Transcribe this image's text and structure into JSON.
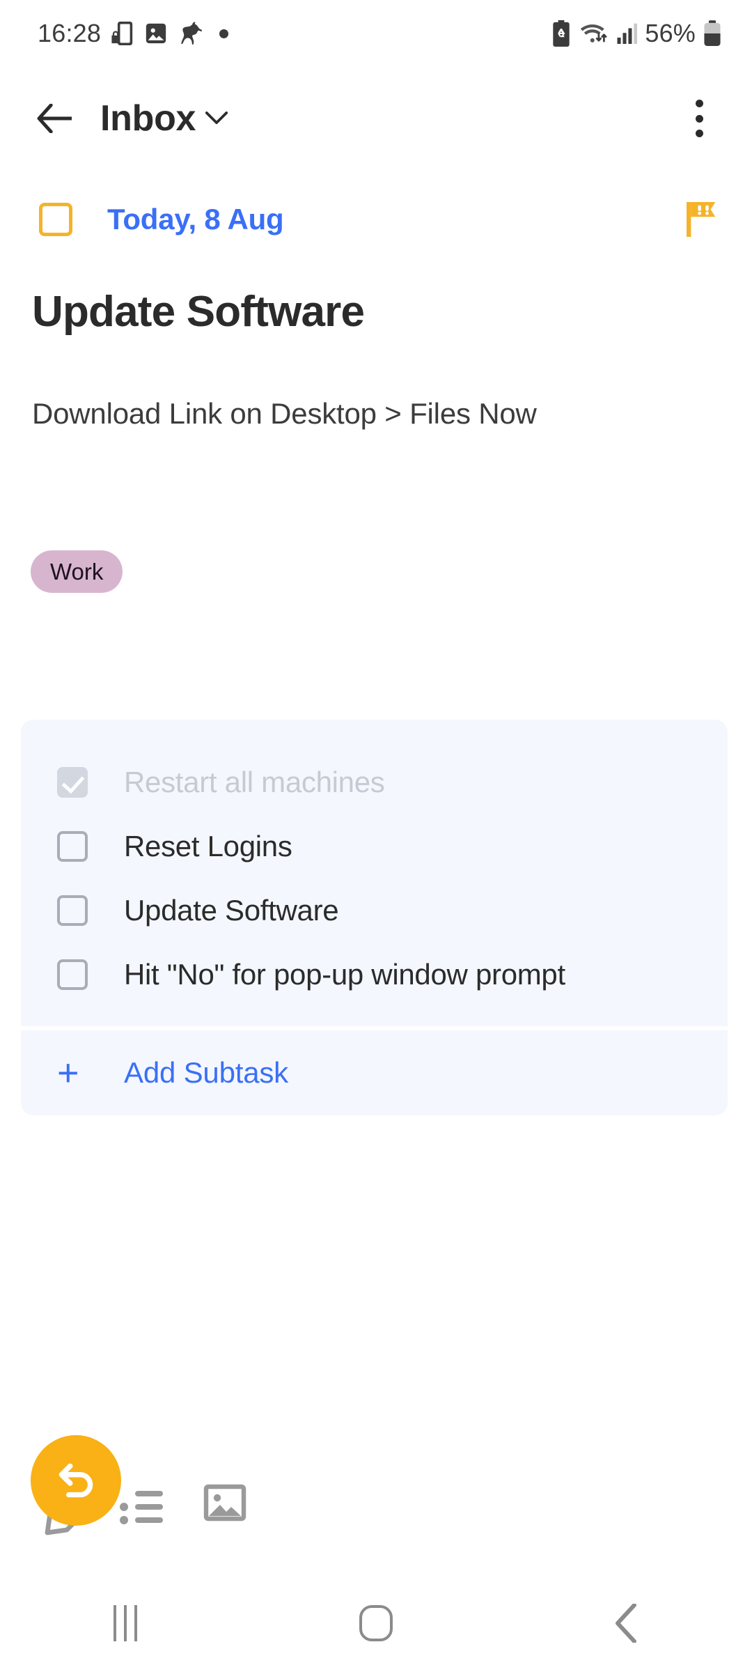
{
  "status_bar": {
    "time": "16:28",
    "battery_pct": "56%",
    "left_icons": [
      "phone-lock-icon",
      "image-icon",
      "horse-icon",
      "dot-icon"
    ],
    "right_icons": [
      "battery-saver-icon",
      "wifi-data-icon",
      "signal-bars-icon",
      "battery-icon"
    ]
  },
  "app_bar": {
    "back_label": "back-arrow",
    "title": "Inbox",
    "dropdown_icon": "chevron-down-icon",
    "overflow_icon": "more-vertical-icon"
  },
  "task": {
    "checkbox_checked": false,
    "due_date": "Today, 8 Aug",
    "priority_flag": "priority-flag-icon",
    "title": "Update Software",
    "description": "Download Link on Desktop > Files Now",
    "tags": [
      {
        "label": "Work",
        "color": "#d7b5cf"
      }
    ]
  },
  "subtasks": {
    "items": [
      {
        "label": "Restart all machines",
        "done": true
      },
      {
        "label": "Reset Logins",
        "done": false
      },
      {
        "label": "Update Software",
        "done": false
      },
      {
        "label": "Hit \"No\" for pop-up window prompt",
        "done": false
      }
    ],
    "add_label": "Add Subtask",
    "add_plus": "+"
  },
  "bottom_toolbar": {
    "undo_icon": "undo-icon",
    "pencil_icon": "pencil-icon",
    "list_icon": "bullet-list-icon",
    "image_icon": "image-icon"
  },
  "nav_bar": {
    "recents": "recents-icon",
    "home": "home-icon",
    "back": "back-chevron-icon"
  },
  "colors": {
    "accent_blue": "#3a6ff7",
    "accent_orange": "#f5b32a",
    "fab_orange": "#f9b116",
    "panel_bg": "#f4f7fd",
    "tag_work": "#d7b5cf"
  }
}
